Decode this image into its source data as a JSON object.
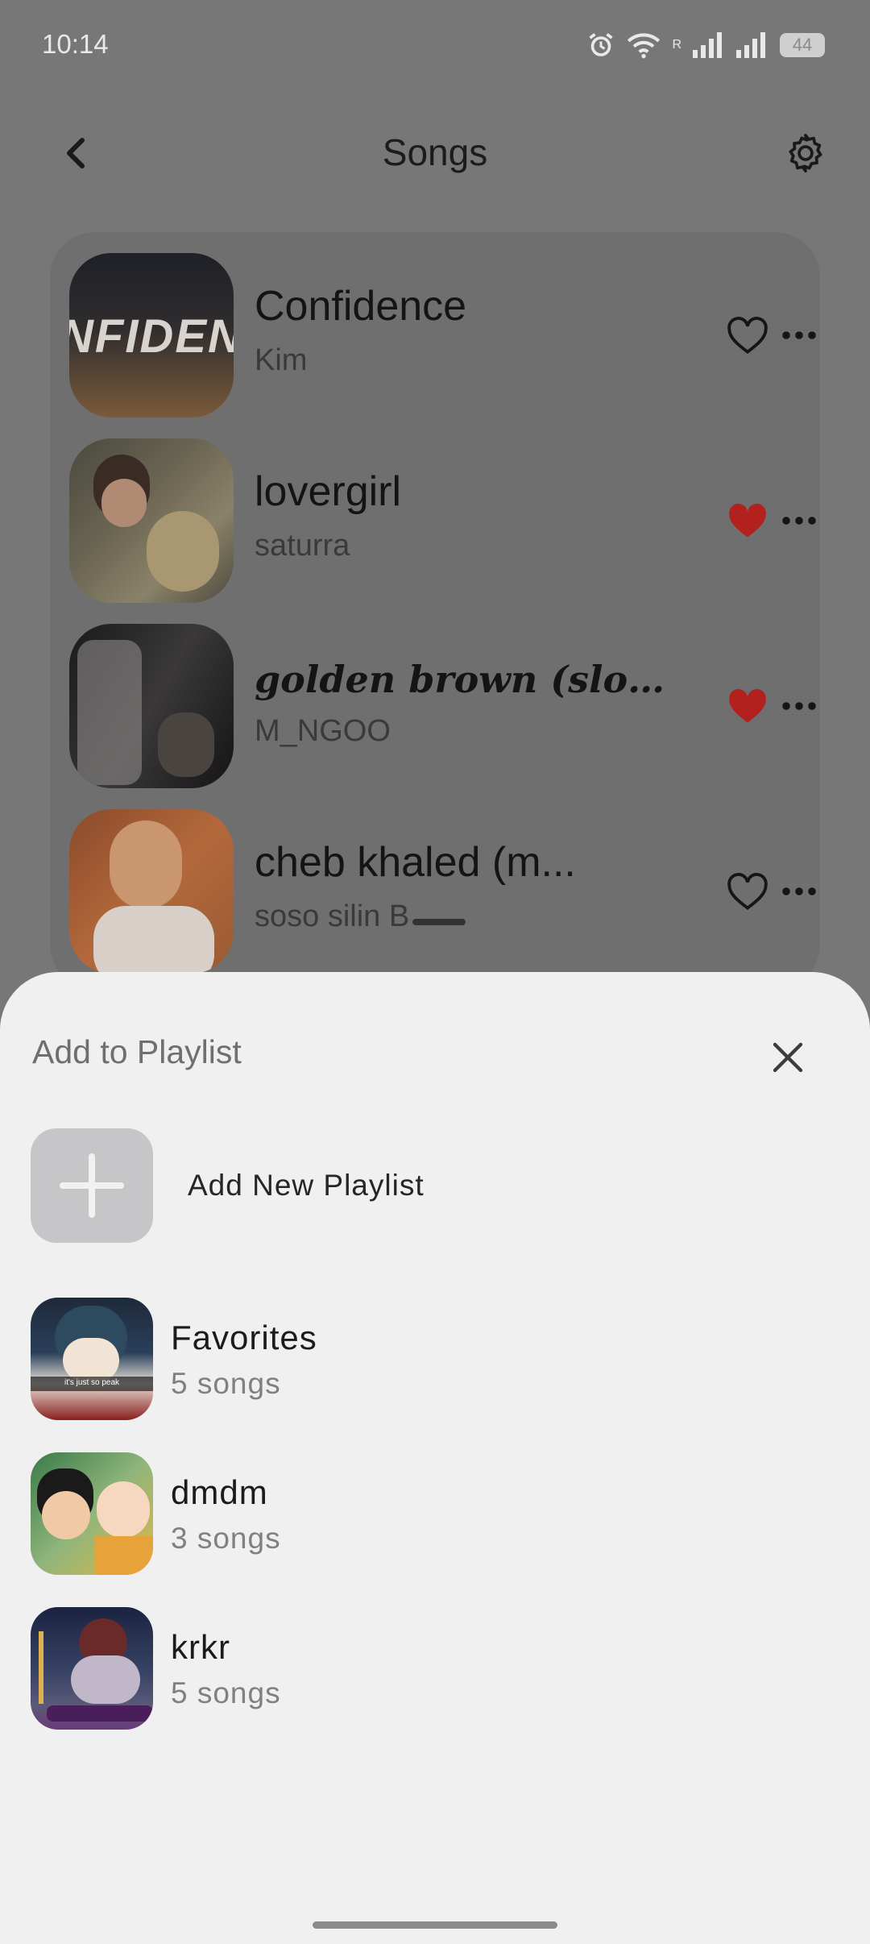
{
  "status": {
    "time": "10:14",
    "battery": "44",
    "network_label": "R"
  },
  "header": {
    "title": "Songs",
    "back_icon": "chevron-left-icon",
    "settings_icon": "gear-icon"
  },
  "songs": [
    {
      "title": "Confidence",
      "artist": "Kim",
      "liked": false,
      "art_text": "NFIDEN"
    },
    {
      "title": "lovergirl",
      "artist": "saturra",
      "liked": true
    },
    {
      "title": "golden brown (slowed ...",
      "artist": "M_NGOO",
      "liked": true
    },
    {
      "title": "cheb khaled (m...",
      "artist": "soso silin B",
      "liked": false
    }
  ],
  "sheet": {
    "title": "Add to Playlist",
    "add_new_label": "Add New Playlist",
    "playlists": [
      {
        "name": "Favorites",
        "count": "5 songs",
        "thumb_caption": "it's just so peak"
      },
      {
        "name": "dmdm",
        "count": "3 songs"
      },
      {
        "name": "krkr",
        "count": "5 songs"
      }
    ]
  },
  "colors": {
    "heart_liked": "#c62828",
    "overlay": "#777777",
    "sheet_bg": "#f0f0f0"
  }
}
